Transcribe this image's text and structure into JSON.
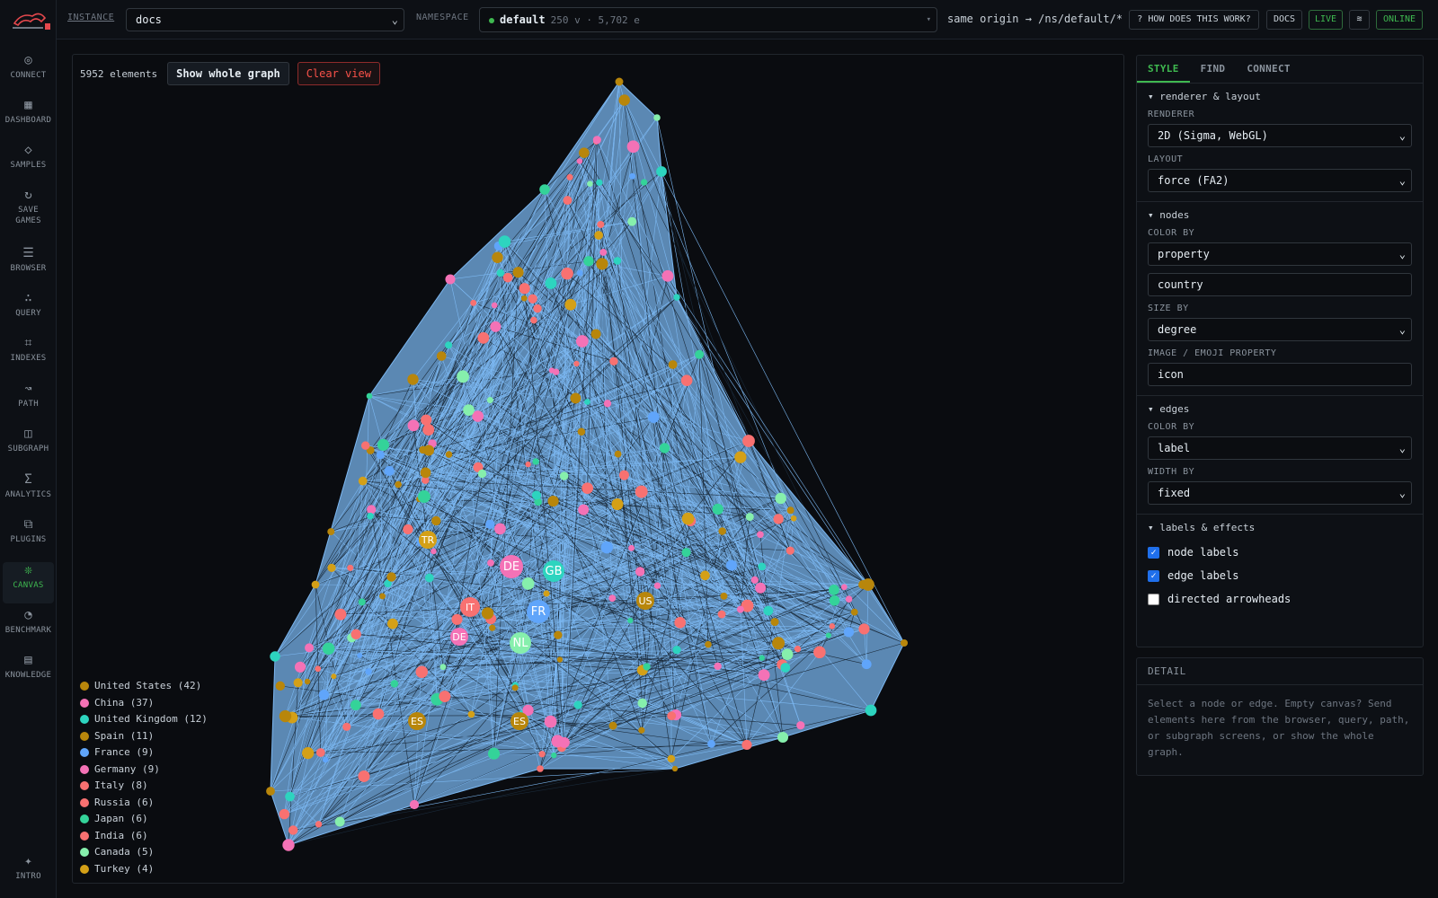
{
  "sidebar": {
    "items": [
      {
        "icon": "◎",
        "label": "CONNECT",
        "icon_name": "connect-icon"
      },
      {
        "icon": "▦",
        "label": "DASHBOARD",
        "icon_name": "dashboard-icon"
      },
      {
        "icon": "◇",
        "label": "SAMPLES",
        "icon_name": "samples-icon"
      },
      {
        "icon": "↻",
        "label": "SAVE\nGAMES",
        "icon_name": "save-games-icon"
      },
      {
        "icon": "☰",
        "label": "BROWSER",
        "icon_name": "browser-icon"
      },
      {
        "icon": "∴",
        "label": "QUERY",
        "icon_name": "query-icon"
      },
      {
        "icon": "⌗",
        "label": "INDEXES",
        "icon_name": "indexes-icon"
      },
      {
        "icon": "↝",
        "label": "PATH",
        "icon_name": "path-icon"
      },
      {
        "icon": "◫",
        "label": "SUBGRAPH",
        "icon_name": "subgraph-icon"
      },
      {
        "icon": "Σ",
        "label": "ANALYTICS",
        "icon_name": "analytics-icon"
      },
      {
        "icon": "⧉",
        "label": "PLUGINS",
        "icon_name": "plugins-icon"
      },
      {
        "icon": "❊",
        "label": "CANVAS",
        "icon_name": "canvas-icon"
      },
      {
        "icon": "◔",
        "label": "BENCHMARK",
        "icon_name": "benchmark-icon"
      },
      {
        "icon": "▤",
        "label": "KNOWLEDGE",
        "icon_name": "knowledge-icon"
      }
    ],
    "intro": {
      "icon": "✦",
      "label": "INTRO"
    }
  },
  "topbar": {
    "instance_label": "INSTANCE",
    "instance_value": "docs",
    "namespace_label": "NAMESPACE",
    "namespace_name": "default",
    "namespace_meta": "250 v · 5,702 e",
    "origin": "same origin → /ns/default/*",
    "help": "? HOW DOES THIS WORK?",
    "docs": "DOCS",
    "live": "LIVE",
    "theme": "≋",
    "online": "ONLINE"
  },
  "canvas": {
    "element_count": "5952 elements",
    "show_whole": "Show whole graph",
    "clear_view": "Clear view"
  },
  "legend": [
    {
      "label": "United States (42)",
      "color": "#b8860b"
    },
    {
      "label": "China (37)",
      "color": "#f472b6"
    },
    {
      "label": "United Kingdom (12)",
      "color": "#2dd4bf"
    },
    {
      "label": "Spain (11)",
      "color": "#b8860b"
    },
    {
      "label": "France (9)",
      "color": "#60a5fa"
    },
    {
      "label": "Germany (9)",
      "color": "#f472b6"
    },
    {
      "label": "Italy (8)",
      "color": "#f87171"
    },
    {
      "label": "Russia (6)",
      "color": "#f87171"
    },
    {
      "label": "Japan (6)",
      "color": "#34d399"
    },
    {
      "label": "India (6)",
      "color": "#f87171"
    },
    {
      "label": "Canada (5)",
      "color": "#86efac"
    },
    {
      "label": "Turkey (4)",
      "color": "#d4a017"
    }
  ],
  "colors": {
    "US": "#b8860b",
    "CN": "#f472b6",
    "GB": "#2dd4bf",
    "ES": "#b8860b",
    "FR": "#60a5fa",
    "DE": "#f472b6",
    "IT": "#f87171",
    "RU": "#f87171",
    "JP": "#34d399",
    "IN": "#f87171",
    "CA": "#86efac",
    "TR": "#d4a017",
    "NL": "#86efac",
    "AE": "#60a5fa",
    "HK": "#f87171",
    "KR": "#34d399",
    "AT": "#f87171",
    "BE": "#f87171",
    "DK": "#a855f7",
    "TW": "#a855f7",
    "edge": "#7cb8f2"
  },
  "graph_labels": {
    "big": [
      {
        "label": "DE"
      },
      {
        "label": "GB"
      },
      {
        "label": "FR"
      },
      {
        "label": "NL"
      },
      {
        "label": "IT"
      },
      {
        "label": "DE"
      },
      {
        "label": "US"
      },
      {
        "label": "ES"
      },
      {
        "label": "ES"
      },
      {
        "label": "TR"
      }
    ]
  },
  "panel": {
    "tabs": [
      "STYLE",
      "FIND",
      "CONNECT"
    ],
    "renderer_section": "▾ renderer & layout",
    "renderer_label": "RENDERER",
    "renderer_value": "2D (Sigma, WebGL)",
    "layout_label": "LAYOUT",
    "layout_value": "force (FA2)",
    "nodes_section": "▾ nodes",
    "color_by_label": "COLOR BY",
    "color_by_value": "property",
    "color_property": "country",
    "size_by_label": "SIZE BY",
    "size_by_value": "degree",
    "image_label": "IMAGE / EMOJI PROPERTY",
    "image_value": "icon",
    "edges_section": "▾ edges",
    "edge_color_label": "COLOR BY",
    "edge_color_value": "label",
    "width_label": "WIDTH BY",
    "width_value": "fixed",
    "labels_section": "▾ labels & effects",
    "check_node_labels": "node labels",
    "check_edge_labels": "edge labels",
    "check_arrowheads": "directed arrowheads"
  },
  "detail": {
    "title": "DETAIL",
    "text": "Select a node or edge. Empty canvas? Send elements here from the browser, query, path, or subgraph screens, or show the whole graph."
  }
}
